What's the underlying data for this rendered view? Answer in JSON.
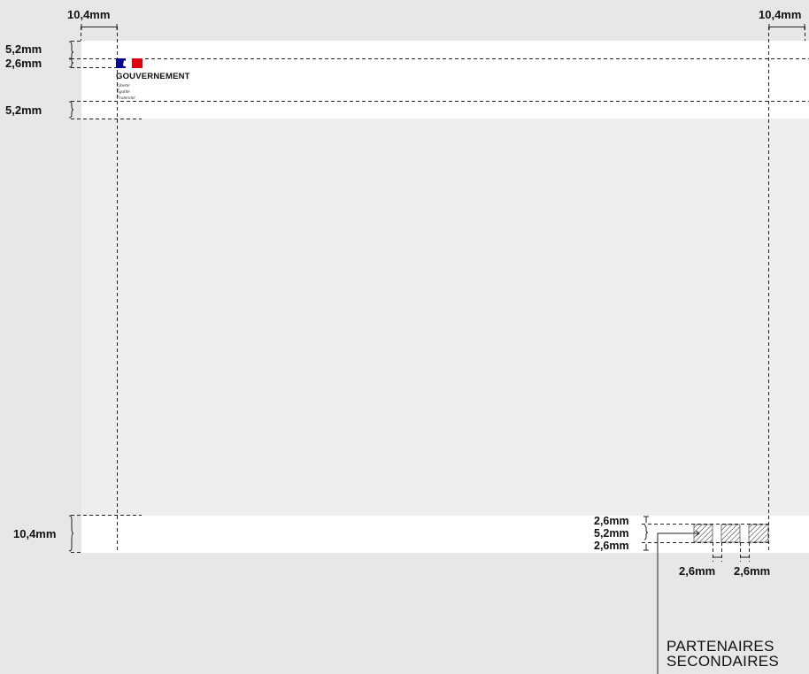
{
  "dimensions": {
    "margin_left": "10,4mm",
    "margin_right": "10,4mm",
    "top_margin": "5,2mm",
    "logo_offset": "2,6mm",
    "header_bottom": "5,2mm",
    "footer_height": "10,4mm",
    "partner_top": "2,6mm",
    "partner_height": "5,2mm",
    "partner_bottom": "2,6mm",
    "partner_gap_1": "2,6mm",
    "partner_gap_2": "2,6mm"
  },
  "logo": {
    "title": "GOUVERNEMENT",
    "motto": [
      "Liberté",
      "Égalité",
      "Fraternité"
    ]
  },
  "partners": {
    "line1": "PARTENAIRES",
    "line2": "SECONDAIRES"
  },
  "colors": {
    "background": "#e7e7e7",
    "page": "#eeeeee",
    "band": "#ffffff",
    "flag_blue": "#000091",
    "flag_red": "#e1000f"
  }
}
